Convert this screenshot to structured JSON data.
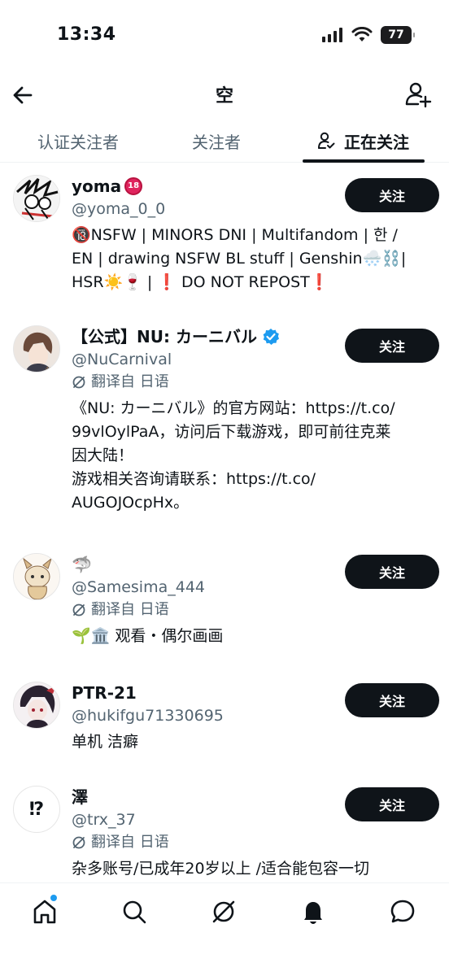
{
  "status_bar": {
    "time": "13:34",
    "battery": "77"
  },
  "header": {
    "title": "空"
  },
  "tabs": [
    {
      "label": "认证关注者"
    },
    {
      "label": "关注者"
    },
    {
      "label": "正在关注"
    }
  ],
  "users": [
    {
      "name": "yoma",
      "handle": "@yoma_0_0",
      "bio": "🔞NSFW | MINORS DNI | Multifandom | 한 /\nEN | drawing NSFW BL stuff | Genshin🌨️⛓️|\nHSR☀️🍷 | ❗ DO NOT REPOST❗",
      "follow_label": "关注"
    },
    {
      "name": "【公式】NU: カーニバル",
      "handle": "@NuCarnival",
      "translate": "翻译自 日语",
      "bio": "《NU: カーニバル》的官方网站：https://t.co/\n99vlOylPaA，访问后下载游戏，即可前往克莱\n因大陆！\n游戏相关咨询请联系：https://t.co/\nAUGOJOcpHx。",
      "follow_label": "关注"
    },
    {
      "name": "🦈",
      "handle": "@Samesima_444",
      "translate": "翻译自 日语",
      "bio": "🌱🏛️  观看・偶尔画画",
      "follow_label": "关注"
    },
    {
      "name": "PTR-21",
      "handle": "@hukifgu71330695",
      "bio": "单机 洁癖",
      "follow_label": "关注"
    },
    {
      "name": "澤",
      "handle": "@trx_37",
      "translate": "翻译自 日语",
      "bio": "杂多账号/已成年20岁以上 /适合能包容一切",
      "follow_label": "关注",
      "avatar_text": "⁉"
    }
  ],
  "badges": {
    "adult": "18"
  },
  "colors": {
    "follow_button": "#0f1419",
    "verified": "#1d9bf0",
    "secondary_text": "#536471"
  }
}
